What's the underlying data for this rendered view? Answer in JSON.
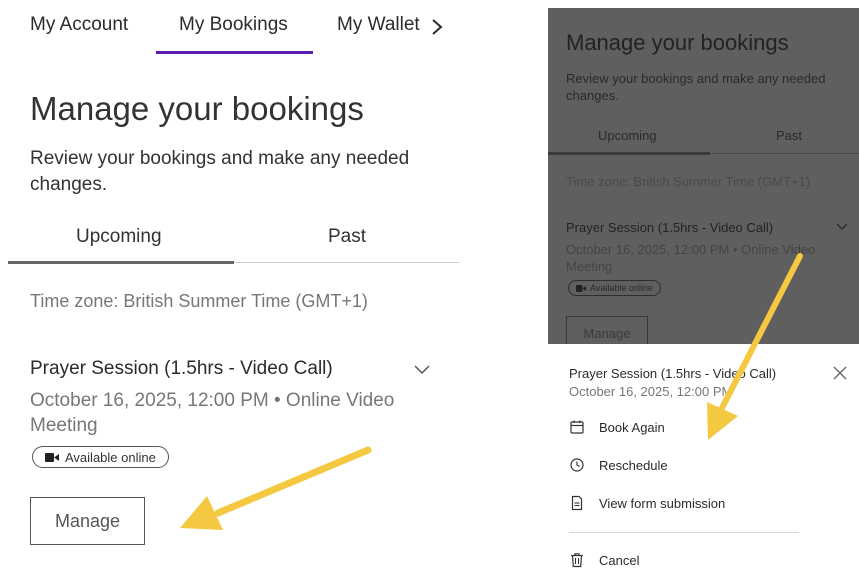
{
  "left": {
    "nav": {
      "account": "My Account",
      "bookings": "My Bookings",
      "wallet": "My Wallet"
    },
    "title": "Manage your bookings",
    "subtitle": "Review your bookings and make any needed changes.",
    "tabs": {
      "upcoming": "Upcoming",
      "past": "Past"
    },
    "timezone": "Time zone: British Summer Time (GMT+1)",
    "booking": {
      "title": "Prayer Session (1.5hrs - Video Call)",
      "datetime": "October 16, 2025, 12:00 PM • Online Video Meeting",
      "badge": "Available online"
    },
    "manage_label": "Manage"
  },
  "right": {
    "title": "Manage your bookings",
    "subtitle": "Review your bookings and make any needed changes.",
    "tabs": {
      "upcoming": "Upcoming",
      "past": "Past"
    },
    "timezone": "Time zone: British Summer Time (GMT+1)",
    "booking": {
      "title": "Prayer Session (1.5hrs - Video Call)",
      "datetime": "October 16, 2025, 12:00 PM • Online Video Meeting",
      "badge": "Available online"
    },
    "manage_label": "Manage",
    "sheet": {
      "title": "Prayer Session (1.5hrs - Video Call)",
      "datetime": "October 16, 2025, 12:00 PM",
      "actions": {
        "book_again": "Book Again",
        "reschedule": "Reschedule",
        "view_form": "View form submission",
        "cancel": "Cancel"
      }
    }
  },
  "colors": {
    "accent": "#5a1bb0",
    "arrow": "#f5c842",
    "overlay": "#5f5f5f"
  }
}
